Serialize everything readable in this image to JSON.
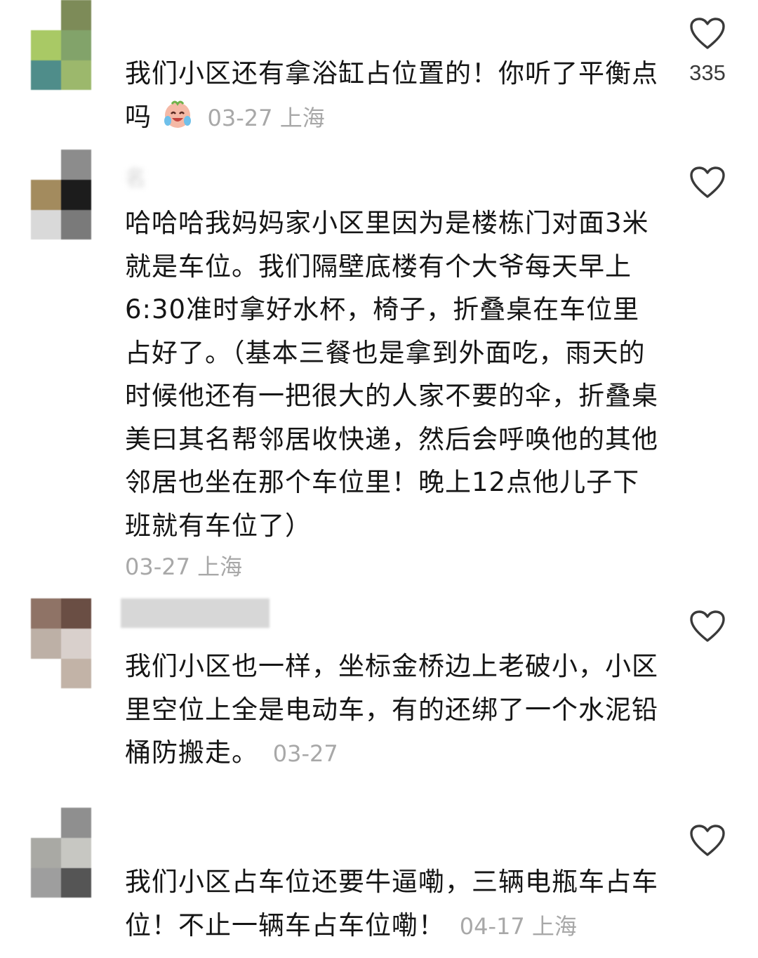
{
  "comments": [
    {
      "username": "",
      "text": "我们小区还有拿浴缸占位置的！你听了平衡点吗",
      "meta": "03-27 上海",
      "likes": "335",
      "avatar_colors": [
        "#ffffff",
        "#7d8b58",
        "#a9c965",
        "#82a36a",
        "#4f8d8a",
        "#9cb86c"
      ]
    },
    {
      "username": "名",
      "text": "哈哈哈我妈妈家小区里因为是楼栋门对面3米就是车位。我们隔壁底楼有个大爷每天早上6:30准时拿好水杯，椅子，折叠桌在车位里占好了。（基本三餐也是拿到外面吃，雨天的时候他还有一把很大的人家不要的伞，折叠桌美曰其名帮邻居收快递，然后会呼唤他的其他邻居也坐在那个车位里！晚上12点他儿子下班就有车位了）",
      "meta": "03-27 上海",
      "likes": "",
      "avatar_colors": [
        "#ffffff",
        "#8c8c8c",
        "#a38b5e",
        "#1c1c1c",
        "#d9d9d9",
        "#7a7a7a"
      ]
    },
    {
      "username": "",
      "text": "我们小区也一样，坐标金桥边上老破小，小区里空位上全是电动车，有的还绑了一个水泥铅桶防搬走。",
      "meta": "03-27",
      "likes": "",
      "avatar_colors": [
        "#8f7366",
        "#6a4e44",
        "#bdb0a6",
        "#d9d0cc",
        "#ffffff",
        "#c2b3a7"
      ]
    },
    {
      "username": "",
      "text": "我们小区占车位还要牛逼嘞，三辆电瓶车占车位！不止一辆车占车位嘞！",
      "meta": "04-17 上海",
      "likes": "",
      "avatar_colors": [
        "#ffffff",
        "#8f8f8f",
        "#a9a9a4",
        "#c7c7c2",
        "#9e9e9e",
        "#555555"
      ]
    }
  ],
  "icons": {
    "like": "heart-outline-icon",
    "emoji": "crying-laughing-face-emoji"
  }
}
